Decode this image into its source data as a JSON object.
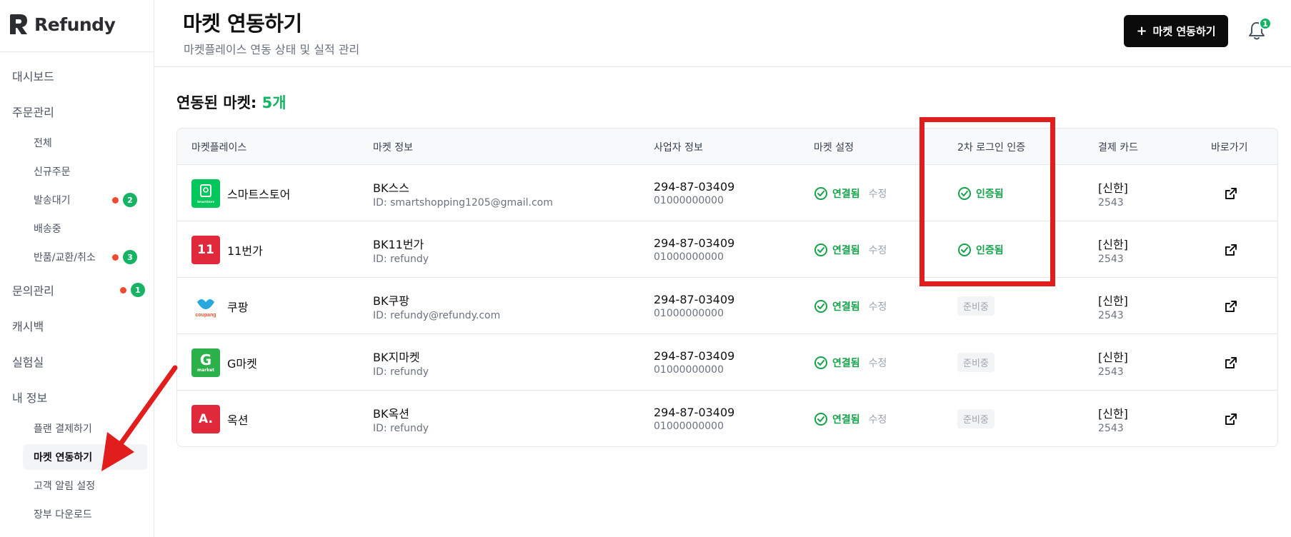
{
  "sidebar": {
    "logo_text": "Refundy",
    "items": [
      {
        "label": "대시보드"
      },
      {
        "label": "주문관리"
      },
      {
        "label": "전체"
      },
      {
        "label": "신규주문"
      },
      {
        "label": "발송대기",
        "badge": "2"
      },
      {
        "label": "배송중"
      },
      {
        "label": "반품/교환/취소",
        "badge": "3"
      },
      {
        "label": "문의관리",
        "badge": "1"
      },
      {
        "label": "캐시백"
      },
      {
        "label": "실험실"
      },
      {
        "label": "내 정보"
      },
      {
        "label": "플랜 결제하기"
      },
      {
        "label": "마켓 연동하기"
      },
      {
        "label": "고객 알림 설정"
      },
      {
        "label": "장부 다운로드"
      }
    ]
  },
  "header": {
    "title": "마켓 연동하기",
    "subtitle": "마켓플레이스 연동 상태 및 실적 관리",
    "button_plus": "+",
    "button_label": "마켓 연동하기",
    "notification_count": "1"
  },
  "section": {
    "title_prefix": "연동된 마켓:",
    "title_count": "5개"
  },
  "table": {
    "columns": [
      "마켓플레이스",
      "마켓 정보",
      "사업자 정보",
      "마켓 설정",
      "2차 로그인 인증",
      "결제 카드",
      "바로가기"
    ],
    "rows": [
      {
        "marketplace": "스마트스토어",
        "logo_color": "#03c75a",
        "logo_text": "SmartStore",
        "market_name": "BK스스",
        "market_id": "ID: smartshopping1205@gmail.com",
        "biz_no": "294-87-03409",
        "biz_phone": "01000000000",
        "setting_status": "연결됨",
        "setting_edit": "수정",
        "auth_status": "인증됨",
        "card_name": "[신한]",
        "card_no": "2543"
      },
      {
        "marketplace": "11번가",
        "logo_color": "#e02a3b",
        "logo_text": "11",
        "market_name": "BK11번가",
        "market_id": "ID: refundy",
        "biz_no": "294-87-03409",
        "biz_phone": "01000000000",
        "setting_status": "연결됨",
        "setting_edit": "수정",
        "auth_status": "인증됨",
        "card_name": "[신한]",
        "card_no": "2543"
      },
      {
        "marketplace": "쿠팡",
        "logo_color": "#ffffff",
        "logo_text": "coupang",
        "market_name": "BK쿠팡",
        "market_id": "ID: refundy@refundy.com",
        "biz_no": "294-87-03409",
        "biz_phone": "01000000000",
        "setting_status": "연결됨",
        "setting_edit": "수정",
        "auth_status": "준비중",
        "card_name": "[신한]",
        "card_no": "2543"
      },
      {
        "marketplace": "G마켓",
        "logo_color": "#2bb04a",
        "logo_text": "G",
        "logo_sub": "market",
        "market_name": "BK지마켓",
        "market_id": "ID: refundy",
        "biz_no": "294-87-03409",
        "biz_phone": "01000000000",
        "setting_status": "연결됨",
        "setting_edit": "수정",
        "auth_status": "준비중",
        "card_name": "[신한]",
        "card_no": "2543"
      },
      {
        "marketplace": "옥션",
        "logo_color": "#e02a3b",
        "logo_text": "A.",
        "market_name": "BK옥션",
        "market_id": "ID: refundy",
        "biz_no": "294-87-03409",
        "biz_phone": "01000000000",
        "setting_status": "연결됨",
        "setting_edit": "수정",
        "auth_status": "준비중",
        "card_name": "[신한]",
        "card_no": "2543"
      }
    ]
  },
  "colors": {
    "accent_green": "#16b364",
    "annotation_red": "#e11d1d",
    "notification_dot": "#ef4a2f"
  },
  "icons": [
    "logo-r-icon",
    "bell-icon",
    "check-circle-icon",
    "external-link-icon",
    "arrow-annotation"
  ]
}
